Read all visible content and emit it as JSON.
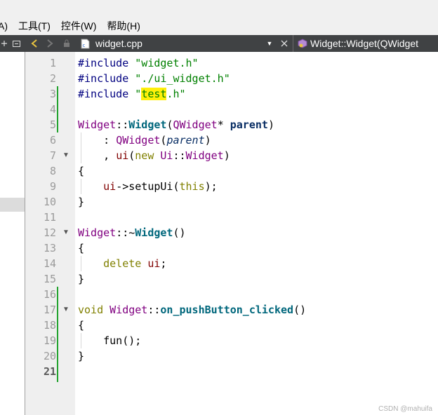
{
  "menubar": {
    "items": [
      "A)",
      "工具(T)",
      "控件(W)",
      "帮助(H)"
    ]
  },
  "toolbar": {
    "file_name": "widget.cpp",
    "symbol": "Widget::Widget(QWidget"
  },
  "editor": {
    "line_numbers": [
      "1",
      "2",
      "3",
      "4",
      "5",
      "6",
      "7",
      "8",
      "9",
      "10",
      "11",
      "12",
      "13",
      "14",
      "15",
      "16",
      "17",
      "18",
      "19",
      "20",
      "21"
    ],
    "current_line": "21",
    "tokens": {
      "include": "#include",
      "widget_h": "\"widget.h\"",
      "ui_widget_h": "\"./ui_widget.h\"",
      "quote": "\"",
      "test": "test",
      "dot_h": ".h\"",
      "widget": "Widget",
      "scope": "::",
      "open_paren": "(",
      "close_paren": ")",
      "empty_parens": "()",
      "qwidget": "QWidget",
      "star": "* ",
      "parent": "parent",
      "colon": ": ",
      "comma": ", ",
      "ui": "ui",
      "new_kw": "new",
      "ui_ns": "Ui",
      "brace_open": "{",
      "brace_close": "}",
      "arrow": "->",
      "setupui": "setupUi",
      "this_kw": "this",
      "close_paren_semicolon": ");",
      "tilde": "~",
      "delete_kw": "delete",
      "semicolon": ";",
      "void_kw": "void",
      "handler": "on_pushButton_clicked",
      "fun": "fun",
      "call_end": "();"
    }
  },
  "watermark": "CSDN @mahuifa"
}
